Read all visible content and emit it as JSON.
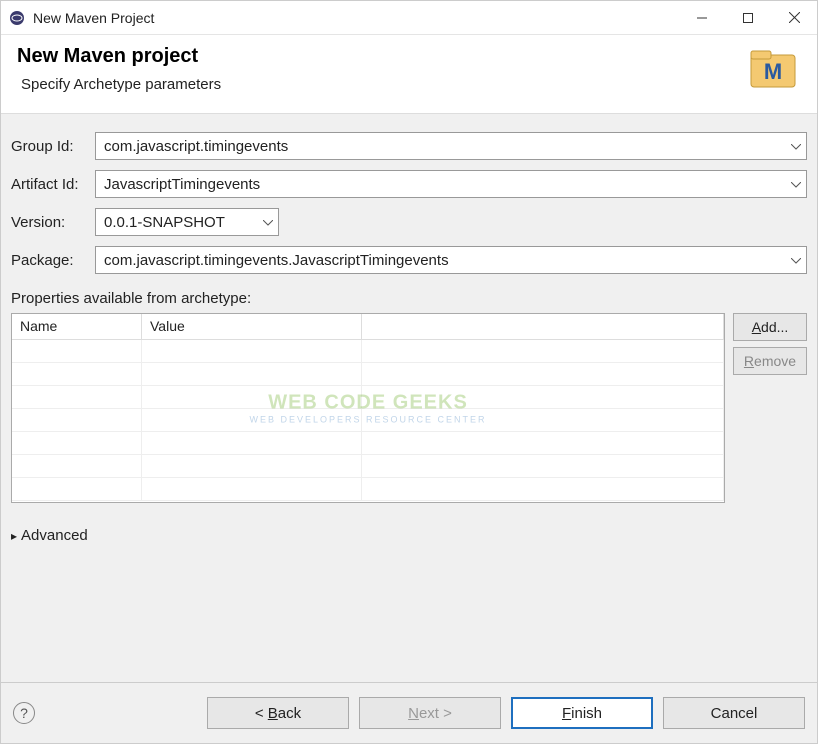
{
  "window": {
    "title": "New Maven Project"
  },
  "header": {
    "title": "New Maven project",
    "subtitle": "Specify Archetype parameters"
  },
  "form": {
    "groupId": {
      "label": "Group Id:",
      "value": "com.javascript.timingevents"
    },
    "artifactId": {
      "label": "Artifact Id:",
      "value": "JavascriptTimingevents"
    },
    "version": {
      "label": "Version:",
      "value": "0.0.1-SNAPSHOT"
    },
    "package": {
      "label": "Package:",
      "value": "com.javascript.timingevents.JavascriptTimingevents"
    }
  },
  "properties": {
    "label": "Properties available from archetype:",
    "columns": {
      "name": "Name",
      "value": "Value"
    },
    "rows": []
  },
  "buttons": {
    "add": "Add...",
    "remove": "Remove"
  },
  "advanced": {
    "label": "Advanced"
  },
  "footer": {
    "back": "< Back",
    "next": "Next >",
    "finish": "Finish",
    "cancel": "Cancel"
  },
  "watermark": {
    "main": "WEB CODE GEEKS",
    "sub": "WEB DEVELOPERS RESOURCE CENTER"
  }
}
